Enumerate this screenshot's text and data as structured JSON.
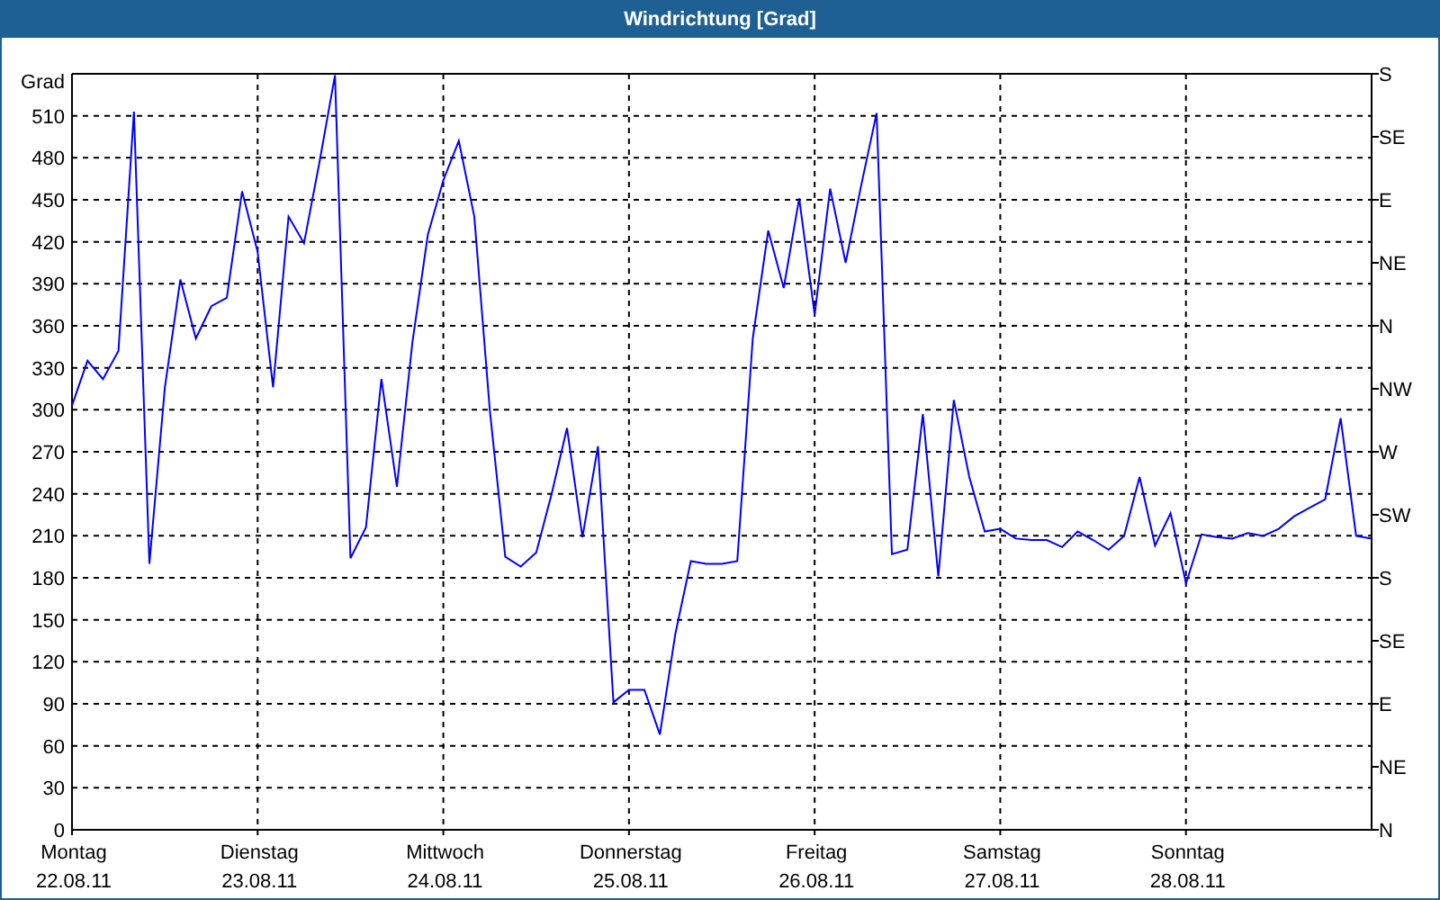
{
  "window": {
    "title": "Windrichtung [Grad]"
  },
  "compass_labels": [
    "S",
    "SE",
    "E",
    "NE",
    "N",
    "NW",
    "W",
    "SW",
    "S",
    "SE",
    "E",
    "NE",
    "N"
  ],
  "weekday_labels": [
    "Montag",
    "Dienstag",
    "Mittwoch",
    "Donnerstag",
    "Freitag",
    "Samstag",
    "Sonntag"
  ],
  "chart_data": {
    "type": "line",
    "grid": true,
    "ylabel": "Grad",
    "ylim": [
      0,
      540
    ],
    "yticks": [
      0,
      30,
      60,
      90,
      120,
      150,
      180,
      210,
      240,
      270,
      300,
      330,
      360,
      390,
      420,
      450,
      480,
      510
    ],
    "categories": [
      "22.08.11",
      null,
      null,
      null,
      null,
      null,
      null,
      null,
      null,
      null,
      null,
      null,
      "23.08.11",
      null,
      null,
      null,
      null,
      null,
      null,
      null,
      null,
      null,
      null,
      null,
      "24.08.11",
      null,
      null,
      null,
      null,
      null,
      null,
      null,
      null,
      null,
      null,
      null,
      "25.08.11",
      null,
      null,
      null,
      null,
      null,
      null,
      null,
      null,
      null,
      null,
      null,
      "26.08.11",
      null,
      null,
      null,
      null,
      null,
      null,
      null,
      null,
      null,
      null,
      null,
      "27.08.11",
      null,
      null,
      null,
      null,
      null,
      null,
      null,
      null,
      null,
      null,
      null,
      "28.08.11",
      null,
      null,
      null,
      null,
      null,
      null,
      null,
      null,
      null,
      null,
      null,
      null
    ],
    "series": [
      {
        "color": "#0000ff",
        "values": [
          303,
          335,
          322,
          342,
          513,
          190,
          316,
          393,
          351,
          374,
          380,
          456,
          413,
          316,
          438,
          419,
          477,
          539,
          194,
          216,
          322,
          245,
          348,
          425,
          464,
          492,
          438,
          300,
          195,
          188,
          198,
          240,
          287,
          209,
          274,
          91,
          100,
          100,
          68,
          140,
          192,
          190,
          190,
          192,
          351,
          428,
          387,
          451,
          368,
          458,
          405,
          460,
          512,
          197,
          200,
          297,
          181,
          307,
          252,
          213,
          215,
          208,
          207,
          207,
          202,
          213,
          207,
          200,
          210,
          252,
          203,
          226,
          176,
          211,
          209,
          208,
          212,
          210,
          215,
          224,
          230,
          236,
          294,
          210,
          208
        ]
      }
    ]
  }
}
